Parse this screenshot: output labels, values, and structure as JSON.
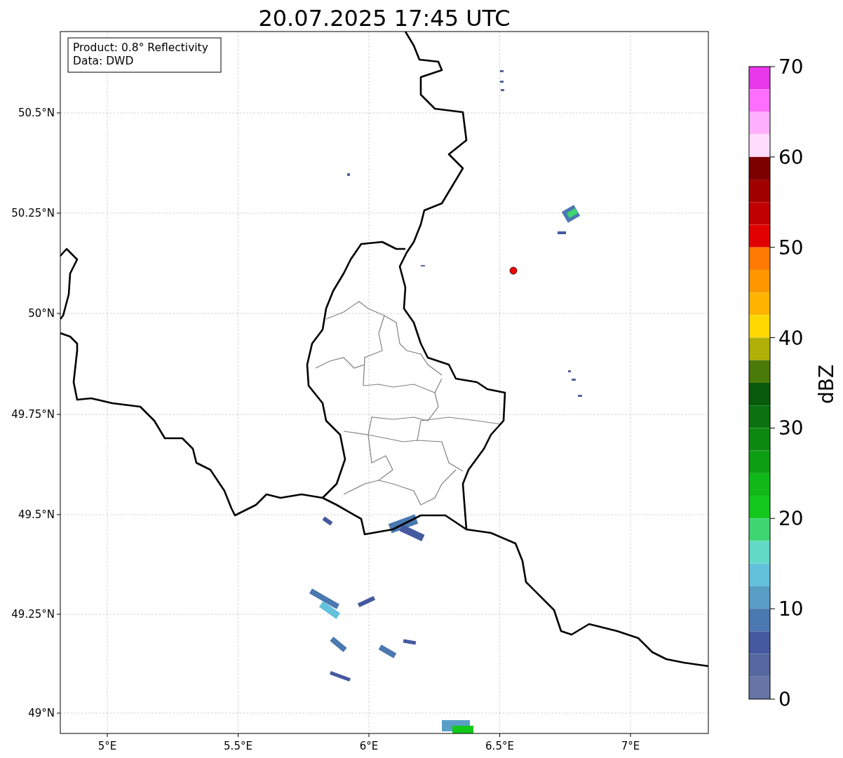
{
  "title": "20.07.2025 17:45 UTC",
  "legend": [
    "Product: 0.8° Reflectivity",
    "Data: DWD"
  ],
  "x_ticks": [
    "5°E",
    "5.5°E",
    "6°E",
    "6.5°E",
    "7°E"
  ],
  "y_ticks": [
    "50.5°N",
    "50.25°N",
    "50°N",
    "49.75°N",
    "49.5°N",
    "49.25°N",
    "49°N"
  ],
  "colorbar": {
    "label": "dBZ",
    "ticks": [
      "70",
      "60",
      "50",
      "40",
      "30",
      "20",
      "10",
      "0"
    ],
    "segments": [
      {
        "color": "#e838ec"
      },
      {
        "color": "#ff6efc"
      },
      {
        "color": "#ffb0fc"
      },
      {
        "color": "#ffdcfc"
      },
      {
        "color": "#7c0000"
      },
      {
        "color": "#a00000"
      },
      {
        "color": "#c00000"
      },
      {
        "color": "#e00000"
      },
      {
        "color": "#fe7a00"
      },
      {
        "color": "#fe9600"
      },
      {
        "color": "#feb400"
      },
      {
        "color": "#fed800"
      },
      {
        "color": "#b0b008"
      },
      {
        "color": "#4a7a0a"
      },
      {
        "color": "#085a0a"
      },
      {
        "color": "#0a720e"
      },
      {
        "color": "#0c8810"
      },
      {
        "color": "#0e9e14"
      },
      {
        "color": "#10b818"
      },
      {
        "color": "#12c81c"
      },
      {
        "color": "#3ed670"
      },
      {
        "color": "#62d9c6"
      },
      {
        "color": "#64c1dc"
      },
      {
        "color": "#5a9ec6"
      },
      {
        "color": "#4a78b0"
      },
      {
        "color": "#44599f"
      },
      {
        "color": "#54679f"
      },
      {
        "color": "#6674a6"
      }
    ]
  }
}
